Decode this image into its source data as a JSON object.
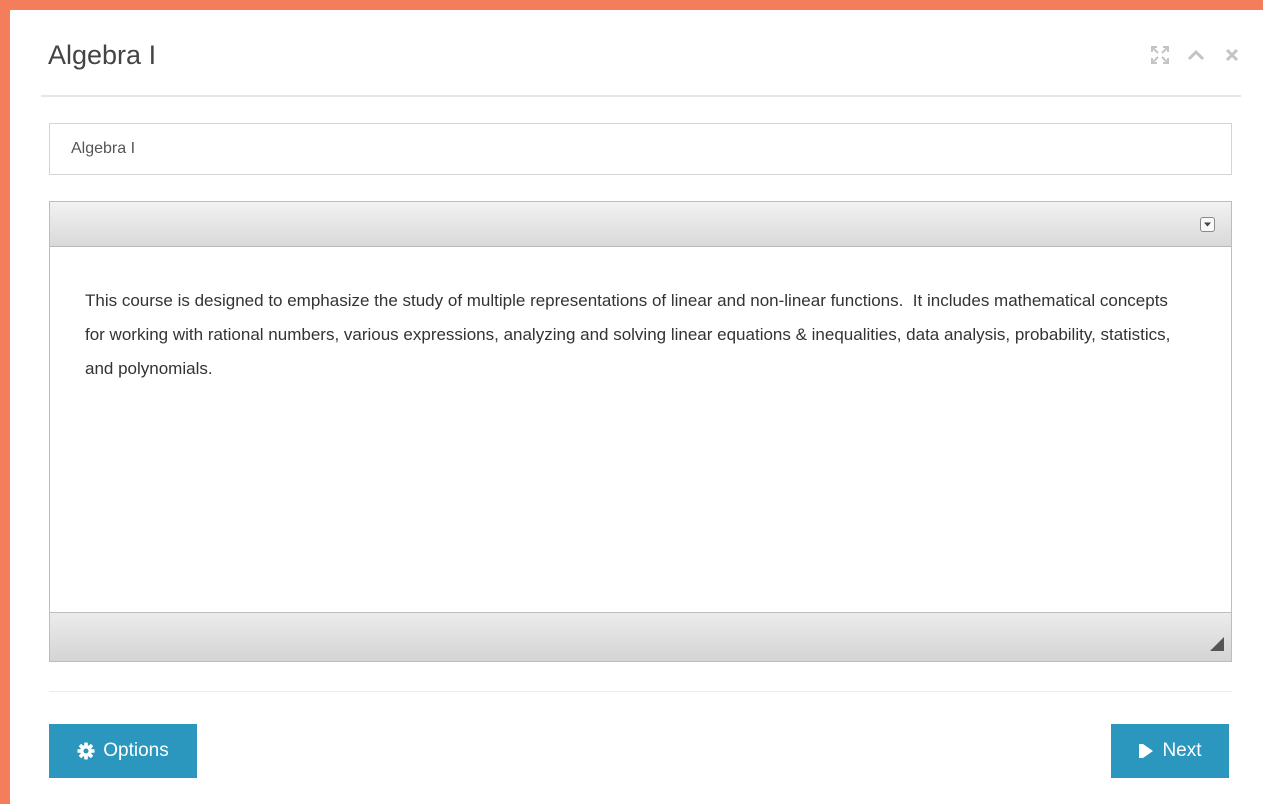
{
  "dialog": {
    "title": "Algebra I",
    "controls": {
      "expand_icon": "expand-icon",
      "collapse_icon": "chevron-up-icon",
      "close_icon": "close-icon"
    }
  },
  "form": {
    "name_value": "Algebra I",
    "description": "This course is designed to emphasize the study of multiple representations of linear and non-linear functions.  It includes mathematical concepts for working with rational numbers, various expressions, analyzing and solving linear equations & inequalities, data analysis, probability, statistics, and polynomials."
  },
  "footer": {
    "options_label": "Options",
    "options_icon": "gear-icon",
    "next_label": "Next",
    "next_icon": "skip-forward-icon"
  },
  "colors": {
    "frame": "#f47d5b",
    "button": "#2c97be"
  }
}
